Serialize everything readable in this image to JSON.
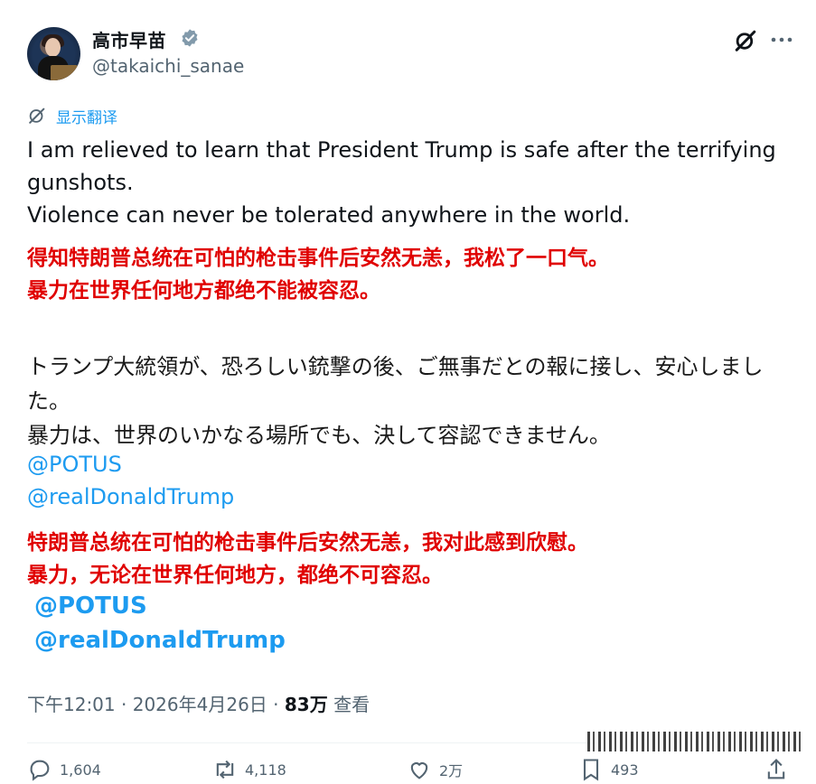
{
  "author": {
    "display_name": "高市早苗",
    "handle": "@takaichi_sanae"
  },
  "translate_label": "显示翻译",
  "tweet": {
    "english_lines": [
      "I am relieved to learn that President Trump is safe after the terrifying gunshots.",
      "Violence can never be tolerated anywhere in the world."
    ],
    "chinese_translation_1": [
      "得知特朗普总统在可怕的枪击事件后安然无恙，我松了一口气。",
      "暴力在世界任何地方都绝不能被容忍。"
    ],
    "japanese_lines": [
      "トランプ大統領が、恐ろしい銃撃の後、ご無事だとの報に接し、安心しました。",
      "暴力は、世界のいかなる場所でも、決して容認できません。"
    ],
    "mentions": [
      "@POTUS",
      "@realDonaldTrump"
    ],
    "chinese_translation_2": [
      "特朗普总统在可怕的枪击事件后安然无恙，我对此感到欣慰。",
      "暴力，无论在世界任何地方，都绝不可容忍。"
    ],
    "mentions_bold": [
      "@POTUS",
      "@realDonaldTrump"
    ]
  },
  "meta": {
    "time": "下午12:01",
    "separator": " · ",
    "date": "2026年4月26日",
    "views_count": "83万",
    "views_label": " 查看"
  },
  "actions": {
    "replies": "1,604",
    "reposts": "4,118",
    "likes": "2万",
    "bookmarks": "493"
  },
  "colors": {
    "accent": "#1d9bf0",
    "annotation_red": "#e00000",
    "secondary_text": "#536471"
  },
  "icons": [
    "verified-icon",
    "grok-icon",
    "more-icon",
    "translate-icon",
    "reply-icon",
    "repost-icon",
    "like-icon",
    "bookmark-icon",
    "share-icon"
  ]
}
